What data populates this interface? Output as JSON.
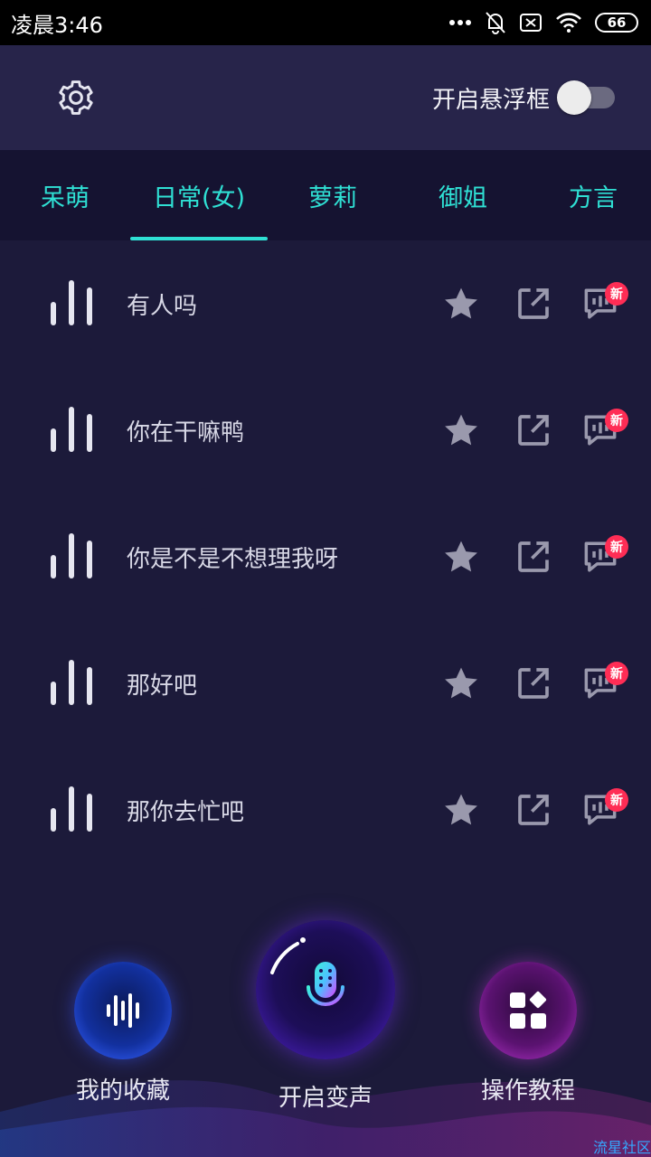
{
  "status_bar": {
    "time": "凌晨3:46",
    "battery": "66"
  },
  "header": {
    "float_label": "开启悬浮框",
    "float_enabled": false
  },
  "tabs": [
    {
      "label": "呆萌",
      "active": false
    },
    {
      "label": "日常(女)",
      "active": true
    },
    {
      "label": "萝莉",
      "active": false
    },
    {
      "label": "御姐",
      "active": false
    },
    {
      "label": "方言",
      "active": false
    }
  ],
  "items": [
    {
      "text": "有人吗",
      "badge": "新"
    },
    {
      "text": "你在干嘛鸭",
      "badge": "新"
    },
    {
      "text": "你是不是不想理我呀",
      "badge": "新"
    },
    {
      "text": "那好吧",
      "badge": "新"
    },
    {
      "text": "那你去忙吧",
      "badge": "新"
    }
  ],
  "bottom_nav": {
    "favorites": "我的收藏",
    "start_voice": "开启变声",
    "tutorial": "操作教程"
  },
  "watermark": "流星社区",
  "colors": {
    "accent": "#2fe0d4",
    "badge": "#ff2d55",
    "background": "#1c1a3a"
  }
}
